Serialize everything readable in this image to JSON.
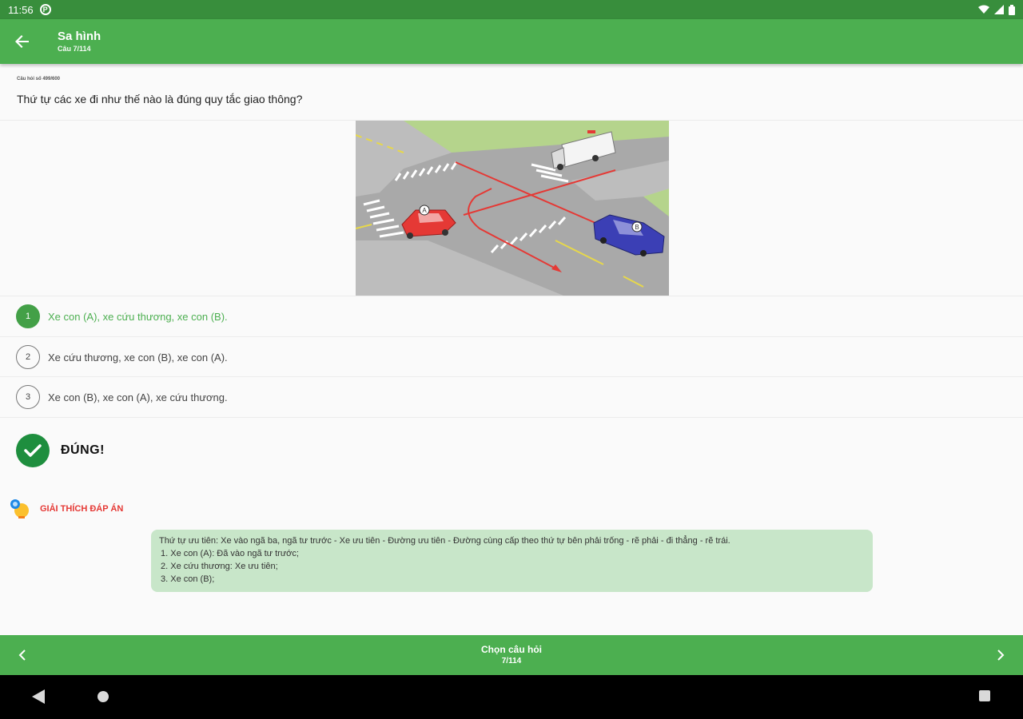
{
  "status_bar": {
    "time": "11:56",
    "app_icon_glyph": "P"
  },
  "app_bar": {
    "title": "Sa hình",
    "subtitle": "Câu 7/114"
  },
  "question": {
    "meta": "Câu hỏi số 499/600",
    "text": "Thứ tự các xe đi như thế nào là đúng quy tắc giao thông?"
  },
  "image": {
    "car_a_label": "A",
    "car_b_label": "B"
  },
  "answers": [
    {
      "number": "1",
      "text": "Xe con (A), xe cứu thương, xe con (B).",
      "state": "correct"
    },
    {
      "number": "2",
      "text": "Xe cứu thương, xe con (B), xe con (A).",
      "state": "normal"
    },
    {
      "number": "3",
      "text": "Xe con (B), xe con (A), xe cứu thương.",
      "state": "normal"
    }
  ],
  "result": {
    "text": "ĐÚNG!"
  },
  "explanation": {
    "title": "GIẢI THÍCH ĐÁP ÁN",
    "lines": [
      "Thứ tự ưu tiên: Xe vào ngã ba, ngã tư trước - Xe ưu tiên - Đường ưu tiên - Đường cùng cấp theo thứ tự bên phải trống - rẽ phải - đi thẳng - rẽ trái.",
      "1. Xe con (A): Đã vào ngã tư trước;",
      "2. Xe cứu thương: Xe ưu tiên;",
      "3. Xe con (B);"
    ]
  },
  "bottom_bar": {
    "label": "Chọn câu hỏi",
    "sub": "7/114"
  },
  "colors": {
    "primary": "#4caf50",
    "primary_dark": "#388e3c",
    "correct": "#43a047",
    "explain_bg": "#c8e6c9",
    "explain_title": "#e53935"
  },
  "icons": {
    "back": "arrow-left-icon",
    "prev": "chevron-left-icon",
    "next": "chevron-right-icon",
    "result": "check-circle-icon",
    "explain": "lightbulb-icon",
    "wifi": "wifi-icon",
    "signal": "signal-icon",
    "battery": "battery-icon",
    "sys_back": "triangle-back-icon",
    "sys_home": "circle-home-icon",
    "sys_recent": "square-recent-icon"
  }
}
